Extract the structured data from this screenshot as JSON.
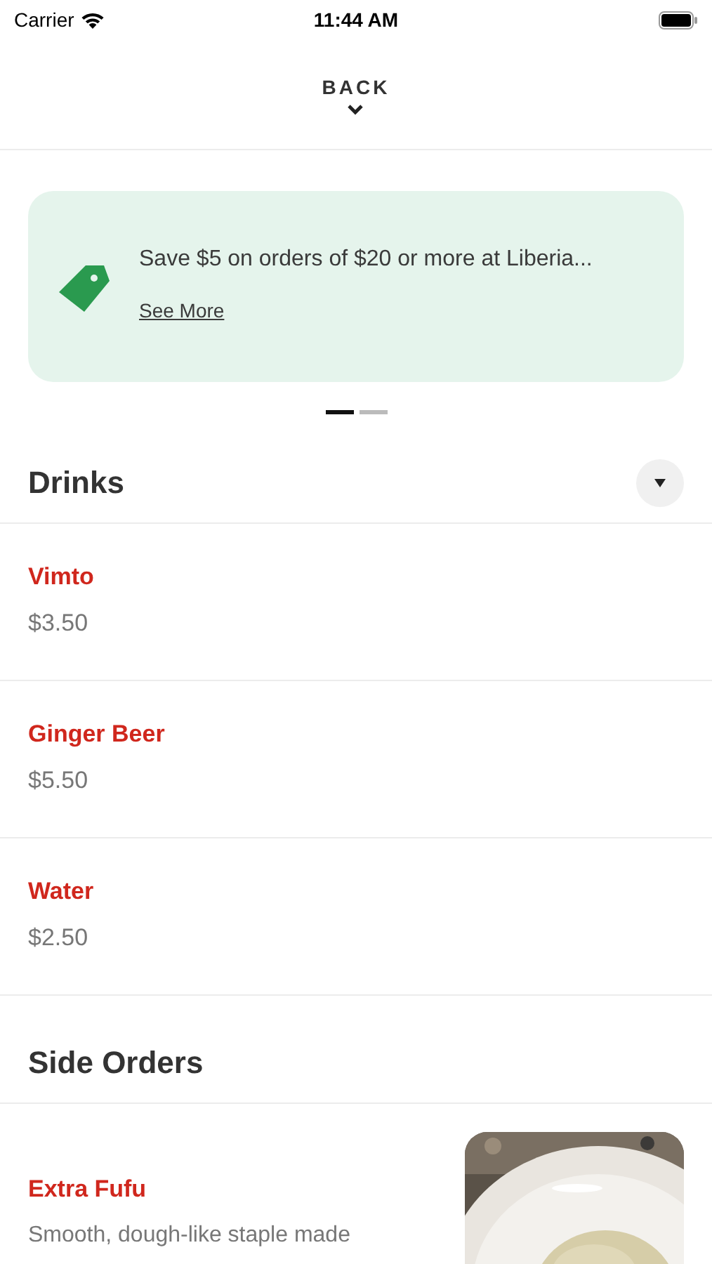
{
  "status_bar": {
    "carrier": "Carrier",
    "time": "11:44 AM"
  },
  "header": {
    "back": "BACK"
  },
  "promo": {
    "text": "Save $5 on orders of $20 or more at Liberia...",
    "link": "See More"
  },
  "carousel_pages": [
    {
      "selected": true
    },
    {
      "selected": false
    }
  ],
  "sections": [
    {
      "title": "Drinks",
      "has_toggle": true,
      "items": [
        {
          "name": "Vimto",
          "price": "$3.50"
        },
        {
          "name": "Ginger Beer",
          "price": "$5.50"
        },
        {
          "name": "Water",
          "price": "$2.50"
        }
      ]
    },
    {
      "title": "Side Orders",
      "has_toggle": false,
      "items": [
        {
          "name": "Extra Fufu",
          "description": "Smooth, dough-like staple made"
        }
      ]
    }
  ]
}
